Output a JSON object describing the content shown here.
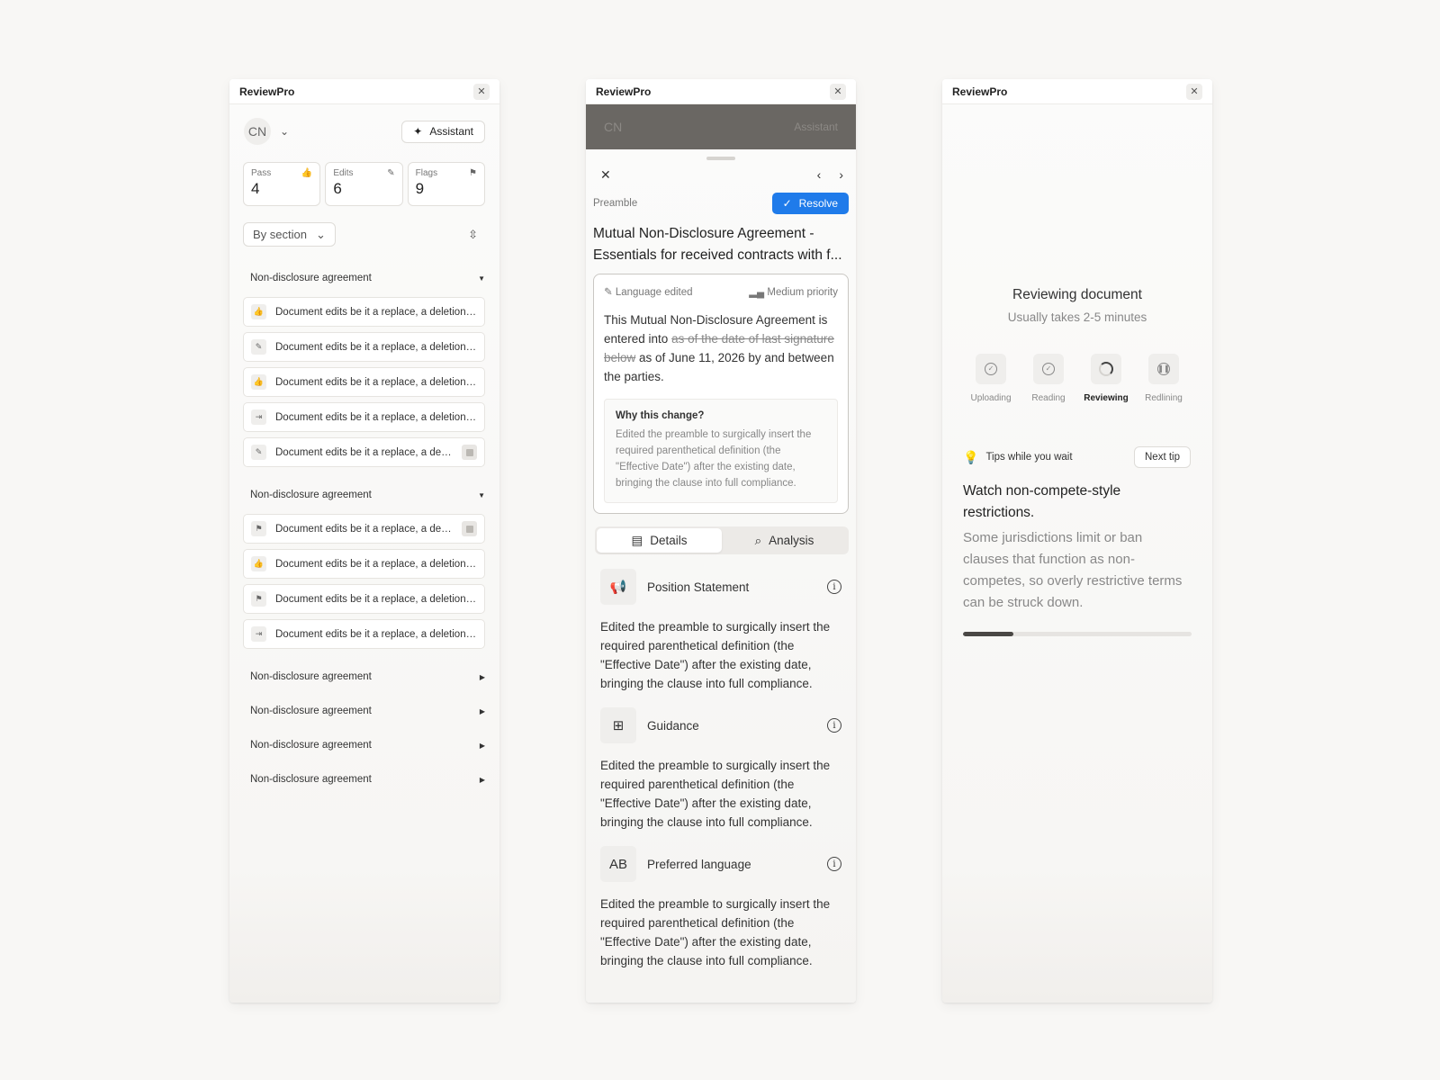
{
  "app_title": "ReviewPro",
  "panel1": {
    "avatar": "CN",
    "assistant_label": "Assistant",
    "stats": [
      {
        "label": "Pass",
        "value": "4",
        "icon": "thumbs-up-icon"
      },
      {
        "label": "Edits",
        "value": "6",
        "icon": "edit-icon"
      },
      {
        "label": "Flags",
        "value": "9",
        "icon": "flag-icon"
      }
    ],
    "filter_label": "By section",
    "sections": [
      {
        "title": "Non-disclosure agreement",
        "expanded": true,
        "items": [
          {
            "text": "Document edits be it a replace, a deletion or an insertion",
            "icon": "thumbs-up-icon",
            "badge": false
          },
          {
            "text": "Document edits be it a replace, a deletion or an insertion",
            "icon": "edit-icon",
            "badge": false
          },
          {
            "text": "Document edits be it a replace, a deletion or an insertion",
            "icon": "thumbs-up-icon",
            "badge": false
          },
          {
            "text": "Document edits be it a replace, a deletion or an insertion",
            "icon": "insert-icon",
            "badge": false
          },
          {
            "text": "Document edits be it a replace, a deletion or an insertion",
            "icon": "edit-icon",
            "badge": true
          }
        ]
      },
      {
        "title": "Non-disclosure agreement",
        "expanded": true,
        "items": [
          {
            "text": "Document edits be it a replace, a deletion or an insertion",
            "icon": "flag-icon",
            "badge": true
          },
          {
            "text": "Document edits be it a replace, a deletion or an insertion",
            "icon": "thumbs-up-icon",
            "badge": false
          },
          {
            "text": "Document edits be it a replace, a deletion or an insertion",
            "icon": "flag-icon",
            "badge": false
          },
          {
            "text": "Document edits be it a replace, a deletion or an insertion",
            "icon": "insert-icon",
            "badge": false
          }
        ]
      },
      {
        "title": "Non-disclosure agreement",
        "expanded": false,
        "items": []
      },
      {
        "title": "Non-disclosure agreement",
        "expanded": false,
        "items": []
      },
      {
        "title": "Non-disclosure agreement",
        "expanded": false,
        "items": []
      },
      {
        "title": "Non-disclosure agreement",
        "expanded": false,
        "items": []
      }
    ]
  },
  "panel2": {
    "bg_avatar": "CN",
    "bg_assistant": "Assistant",
    "section_label": "Preamble",
    "resolve_label": "Resolve",
    "title_line1": "Mutual Non-Disclosure Agreement -",
    "title_line2": "Essentials for received contracts with f...",
    "change_type": "Language edited",
    "priority": "Medium priority",
    "body_before": "This Mutual Non-Disclosure Agreement is entered into ",
    "body_struck": "as of the date of last signature below",
    "body_after": " as of June 11, 2026 by and between the parties.",
    "why_title": "Why this change?",
    "why_text": "Edited the preamble to surgically insert the required parenthetical definition (the \"Effective Date\") after the existing date, bringing the clause into full compliance.",
    "tabs": [
      {
        "label": "Details",
        "icon": "document-icon",
        "active": true
      },
      {
        "label": "Analysis",
        "icon": "search-icon",
        "active": false
      }
    ],
    "details": [
      {
        "title": "Position Statement",
        "icon": "megaphone-icon",
        "glyph": "📢",
        "text": "Edited the preamble to surgically insert the required parenthetical definition (the \"Effective Date\") after the existing date, bringing the clause into full compliance."
      },
      {
        "title": "Guidance",
        "icon": "signpost-icon",
        "glyph": "⊞",
        "text": "Edited the preamble to surgically insert the required parenthetical definition (the \"Effective Date\") after the existing date, bringing the clause into full compliance."
      },
      {
        "title": "Preferred language",
        "icon": "spellcheck-icon",
        "glyph": "AB",
        "text": "Edited the preamble to surgically insert the required parenthetical definition (the \"Effective Date\") after the existing date, bringing the clause into full compliance."
      }
    ]
  },
  "panel3": {
    "title": "Reviewing document",
    "subtitle": "Usually takes 2-5 minutes",
    "steps": [
      {
        "label": "Uploading",
        "state": "done"
      },
      {
        "label": "Reading",
        "state": "done"
      },
      {
        "label": "Reviewing",
        "state": "current"
      },
      {
        "label": "Redlining",
        "state": "pending"
      }
    ],
    "tips_label": "Tips while you wait",
    "next_tip_label": "Next tip",
    "tip_title": "Watch non-compete-style restrictions.",
    "tip_body": "Some jurisdictions limit or ban clauses that function as non-competes, so overly restrictive terms can be struck down.",
    "progress_fraction": 0.22
  }
}
